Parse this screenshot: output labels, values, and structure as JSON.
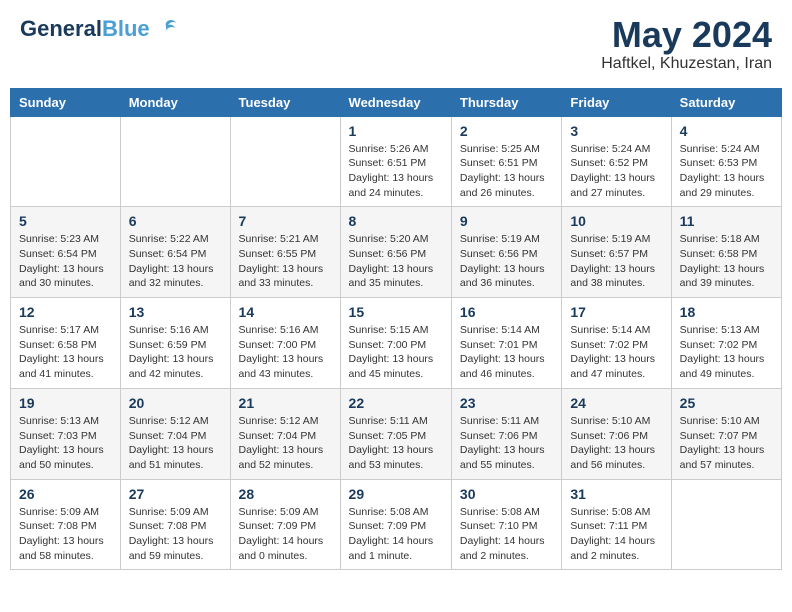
{
  "header": {
    "logo_general": "General",
    "logo_blue": "Blue",
    "title": "May 2024",
    "location": "Haftkel, Khuzestan, Iran"
  },
  "days_of_week": [
    "Sunday",
    "Monday",
    "Tuesday",
    "Wednesday",
    "Thursday",
    "Friday",
    "Saturday"
  ],
  "weeks": [
    [
      {
        "day": "",
        "info": ""
      },
      {
        "day": "",
        "info": ""
      },
      {
        "day": "",
        "info": ""
      },
      {
        "day": "1",
        "info": "Sunrise: 5:26 AM\nSunset: 6:51 PM\nDaylight: 13 hours\nand 24 minutes."
      },
      {
        "day": "2",
        "info": "Sunrise: 5:25 AM\nSunset: 6:51 PM\nDaylight: 13 hours\nand 26 minutes."
      },
      {
        "day": "3",
        "info": "Sunrise: 5:24 AM\nSunset: 6:52 PM\nDaylight: 13 hours\nand 27 minutes."
      },
      {
        "day": "4",
        "info": "Sunrise: 5:24 AM\nSunset: 6:53 PM\nDaylight: 13 hours\nand 29 minutes."
      }
    ],
    [
      {
        "day": "5",
        "info": "Sunrise: 5:23 AM\nSunset: 6:54 PM\nDaylight: 13 hours\nand 30 minutes."
      },
      {
        "day": "6",
        "info": "Sunrise: 5:22 AM\nSunset: 6:54 PM\nDaylight: 13 hours\nand 32 minutes."
      },
      {
        "day": "7",
        "info": "Sunrise: 5:21 AM\nSunset: 6:55 PM\nDaylight: 13 hours\nand 33 minutes."
      },
      {
        "day": "8",
        "info": "Sunrise: 5:20 AM\nSunset: 6:56 PM\nDaylight: 13 hours\nand 35 minutes."
      },
      {
        "day": "9",
        "info": "Sunrise: 5:19 AM\nSunset: 6:56 PM\nDaylight: 13 hours\nand 36 minutes."
      },
      {
        "day": "10",
        "info": "Sunrise: 5:19 AM\nSunset: 6:57 PM\nDaylight: 13 hours\nand 38 minutes."
      },
      {
        "day": "11",
        "info": "Sunrise: 5:18 AM\nSunset: 6:58 PM\nDaylight: 13 hours\nand 39 minutes."
      }
    ],
    [
      {
        "day": "12",
        "info": "Sunrise: 5:17 AM\nSunset: 6:58 PM\nDaylight: 13 hours\nand 41 minutes."
      },
      {
        "day": "13",
        "info": "Sunrise: 5:16 AM\nSunset: 6:59 PM\nDaylight: 13 hours\nand 42 minutes."
      },
      {
        "day": "14",
        "info": "Sunrise: 5:16 AM\nSunset: 7:00 PM\nDaylight: 13 hours\nand 43 minutes."
      },
      {
        "day": "15",
        "info": "Sunrise: 5:15 AM\nSunset: 7:00 PM\nDaylight: 13 hours\nand 45 minutes."
      },
      {
        "day": "16",
        "info": "Sunrise: 5:14 AM\nSunset: 7:01 PM\nDaylight: 13 hours\nand 46 minutes."
      },
      {
        "day": "17",
        "info": "Sunrise: 5:14 AM\nSunset: 7:02 PM\nDaylight: 13 hours\nand 47 minutes."
      },
      {
        "day": "18",
        "info": "Sunrise: 5:13 AM\nSunset: 7:02 PM\nDaylight: 13 hours\nand 49 minutes."
      }
    ],
    [
      {
        "day": "19",
        "info": "Sunrise: 5:13 AM\nSunset: 7:03 PM\nDaylight: 13 hours\nand 50 minutes."
      },
      {
        "day": "20",
        "info": "Sunrise: 5:12 AM\nSunset: 7:04 PM\nDaylight: 13 hours\nand 51 minutes."
      },
      {
        "day": "21",
        "info": "Sunrise: 5:12 AM\nSunset: 7:04 PM\nDaylight: 13 hours\nand 52 minutes."
      },
      {
        "day": "22",
        "info": "Sunrise: 5:11 AM\nSunset: 7:05 PM\nDaylight: 13 hours\nand 53 minutes."
      },
      {
        "day": "23",
        "info": "Sunrise: 5:11 AM\nSunset: 7:06 PM\nDaylight: 13 hours\nand 55 minutes."
      },
      {
        "day": "24",
        "info": "Sunrise: 5:10 AM\nSunset: 7:06 PM\nDaylight: 13 hours\nand 56 minutes."
      },
      {
        "day": "25",
        "info": "Sunrise: 5:10 AM\nSunset: 7:07 PM\nDaylight: 13 hours\nand 57 minutes."
      }
    ],
    [
      {
        "day": "26",
        "info": "Sunrise: 5:09 AM\nSunset: 7:08 PM\nDaylight: 13 hours\nand 58 minutes."
      },
      {
        "day": "27",
        "info": "Sunrise: 5:09 AM\nSunset: 7:08 PM\nDaylight: 13 hours\nand 59 minutes."
      },
      {
        "day": "28",
        "info": "Sunrise: 5:09 AM\nSunset: 7:09 PM\nDaylight: 14 hours\nand 0 minutes."
      },
      {
        "day": "29",
        "info": "Sunrise: 5:08 AM\nSunset: 7:09 PM\nDaylight: 14 hours\nand 1 minute."
      },
      {
        "day": "30",
        "info": "Sunrise: 5:08 AM\nSunset: 7:10 PM\nDaylight: 14 hours\nand 2 minutes."
      },
      {
        "day": "31",
        "info": "Sunrise: 5:08 AM\nSunset: 7:11 PM\nDaylight: 14 hours\nand 2 minutes."
      },
      {
        "day": "",
        "info": ""
      }
    ]
  ]
}
